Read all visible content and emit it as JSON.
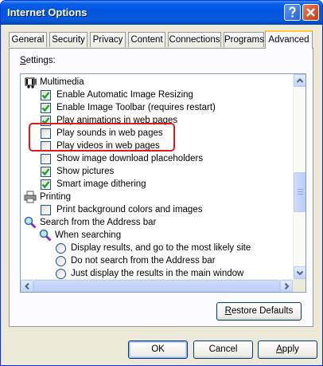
{
  "window": {
    "title": "Internet Options",
    "help_button": "?",
    "close_button": "X"
  },
  "tabs": [
    {
      "label": "General"
    },
    {
      "label": "Security"
    },
    {
      "label": "Privacy"
    },
    {
      "label": "Content"
    },
    {
      "label": "Connections"
    },
    {
      "label": "Programs"
    },
    {
      "label": "Advanced",
      "active": true
    }
  ],
  "settings_label": {
    "mnemonic": "S",
    "rest": "ettings:"
  },
  "settings": {
    "multimedia": {
      "label": "Multimedia",
      "icon": "multimedia-icon",
      "items": [
        {
          "label": "Enable Automatic Image Resizing",
          "checked": true
        },
        {
          "label": "Enable Image Toolbar (requires restart)",
          "checked": true
        },
        {
          "label": "Play animations in web pages",
          "checked": true
        },
        {
          "label": "Play sounds in web pages",
          "checked": false
        },
        {
          "label": "Play videos in web pages",
          "checked": false
        },
        {
          "label": "Show image download placeholders",
          "checked": false
        },
        {
          "label": "Show pictures",
          "checked": true
        },
        {
          "label": "Smart image dithering",
          "checked": true
        }
      ]
    },
    "printing": {
      "label": "Printing",
      "icon": "printer-icon",
      "items": [
        {
          "label": "Print background colors and images",
          "checked": false
        }
      ]
    },
    "search": {
      "label": "Search from the Address bar",
      "icon": "magnifier-icon",
      "sub": {
        "label": "When searching",
        "icon": "magnifier-icon",
        "options": [
          {
            "label": "Display results, and go to the most likely site",
            "selected": false
          },
          {
            "label": "Do not search from the Address bar",
            "selected": false
          },
          {
            "label": "Just display the results in the main window",
            "selected": false
          }
        ]
      }
    }
  },
  "restore_defaults": {
    "mnemonic": "R",
    "rest": "estore Defaults"
  },
  "dialog_buttons": {
    "ok": "OK",
    "cancel": "Cancel",
    "apply": {
      "mnemonic": "A",
      "rest": "pply"
    }
  },
  "colors": {
    "titlebar": "#0054e3",
    "dialog_bg": "#ece9d8",
    "check_mark": "#21a121",
    "highlight": "#e01a1a",
    "active_tab_accent": "#ffc83c"
  }
}
